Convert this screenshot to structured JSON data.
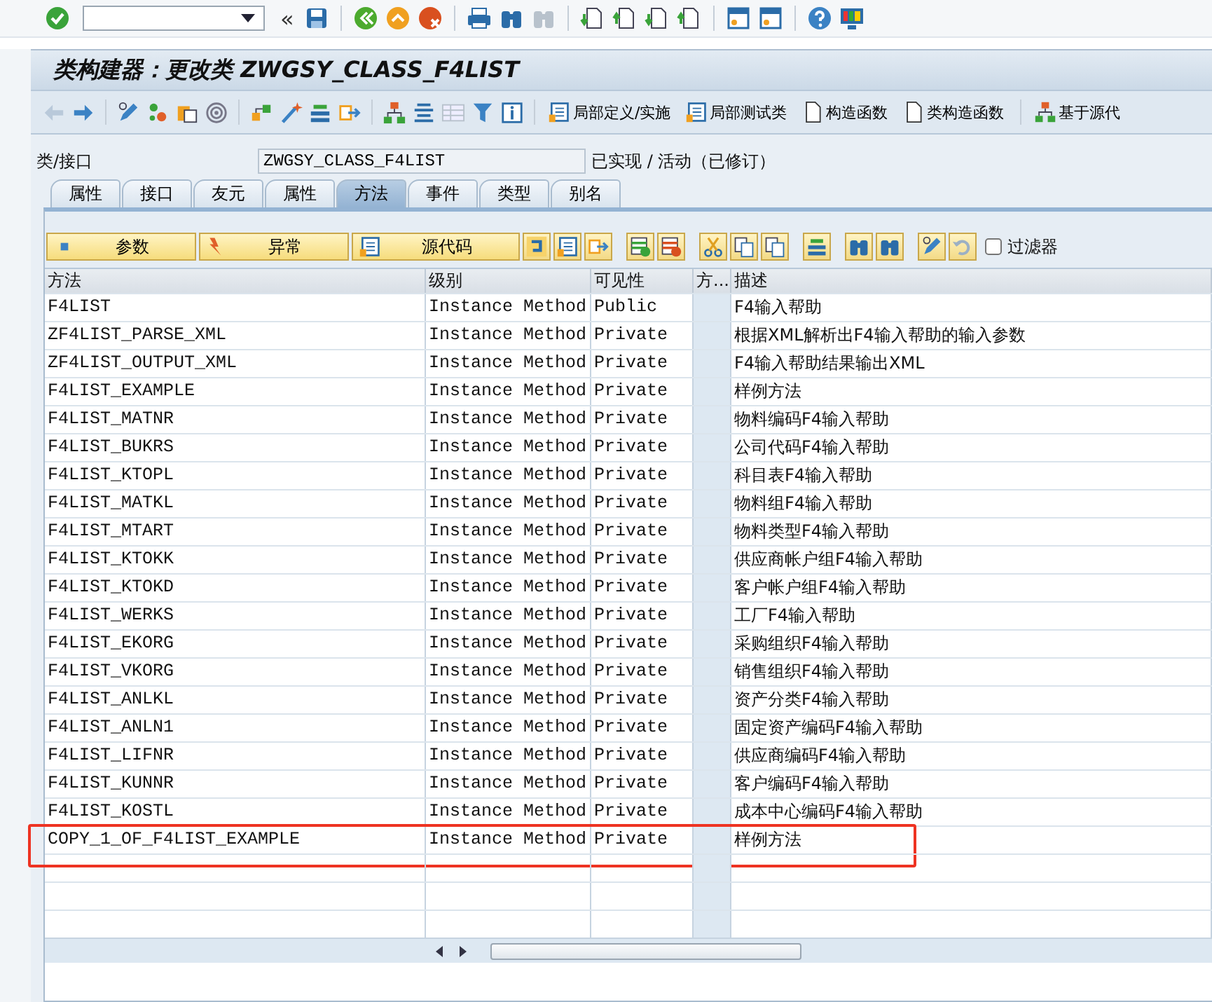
{
  "toolbar": {
    "collapse": "«"
  },
  "title": "类构建器：更改类 ZWGSY_CLASS_F4LIST",
  "app_toolbar": {
    "buttons": [
      "局部定义/实施",
      "局部测试类",
      "构造函数",
      "类构造函数",
      "基于源代"
    ]
  },
  "class_field": {
    "label": "类/接口",
    "value": "ZWGSY_CLASS_F4LIST",
    "status": "已实现 / 活动（已修订）"
  },
  "tabs": [
    {
      "label": "属性",
      "selected": false
    },
    {
      "label": "接口",
      "selected": false
    },
    {
      "label": "友元",
      "selected": false
    },
    {
      "label": "属性",
      "selected": false
    },
    {
      "label": "方法",
      "selected": true
    },
    {
      "label": "事件",
      "selected": false
    },
    {
      "label": "类型",
      "selected": false
    },
    {
      "label": "别名",
      "selected": false
    }
  ],
  "method_toolbar": {
    "buttons": [
      "参数",
      "异常",
      "源代码"
    ],
    "filter": {
      "label": "过滤器",
      "checked": false
    }
  },
  "table": {
    "columns": [
      "方法",
      "级别",
      "可见性",
      "方...",
      "描述"
    ],
    "rows": [
      {
        "method": "F4LIST",
        "scope": "Instance Method",
        "visibility": "Public",
        "description": "F4输入帮助",
        "highlighted": false
      },
      {
        "method": "ZF4LIST_PARSE_XML",
        "scope": "Instance Method",
        "visibility": "Private",
        "description": "根据XML解析出F4输入帮助的输入参数",
        "highlighted": false
      },
      {
        "method": "ZF4LIST_OUTPUT_XML",
        "scope": "Instance Method",
        "visibility": "Private",
        "description": "F4输入帮助结果输出XML",
        "highlighted": false
      },
      {
        "method": "F4LIST_EXAMPLE",
        "scope": "Instance Method",
        "visibility": "Private",
        "description": "样例方法",
        "highlighted": false
      },
      {
        "method": "F4LIST_MATNR",
        "scope": "Instance Method",
        "visibility": "Private",
        "description": "物料编码F4输入帮助",
        "highlighted": false
      },
      {
        "method": "F4LIST_BUKRS",
        "scope": "Instance Method",
        "visibility": "Private",
        "description": "公司代码F4输入帮助",
        "highlighted": false
      },
      {
        "method": "F4LIST_KTOPL",
        "scope": "Instance Method",
        "visibility": "Private",
        "description": "科目表F4输入帮助",
        "highlighted": false
      },
      {
        "method": "F4LIST_MATKL",
        "scope": "Instance Method",
        "visibility": "Private",
        "description": "物料组F4输入帮助",
        "highlighted": false
      },
      {
        "method": "F4LIST_MTART",
        "scope": "Instance Method",
        "visibility": "Private",
        "description": "物料类型F4输入帮助",
        "highlighted": false
      },
      {
        "method": "F4LIST_KTOKK",
        "scope": "Instance Method",
        "visibility": "Private",
        "description": "供应商帐户组F4输入帮助",
        "highlighted": false
      },
      {
        "method": "F4LIST_KTOKD",
        "scope": "Instance Method",
        "visibility": "Private",
        "description": "客户帐户组F4输入帮助",
        "highlighted": false
      },
      {
        "method": "F4LIST_WERKS",
        "scope": "Instance Method",
        "visibility": "Private",
        "description": "工厂F4输入帮助",
        "highlighted": false
      },
      {
        "method": "F4LIST_EKORG",
        "scope": "Instance Method",
        "visibility": "Private",
        "description": "采购组织F4输入帮助",
        "highlighted": false
      },
      {
        "method": "F4LIST_VKORG",
        "scope": "Instance Method",
        "visibility": "Private",
        "description": "销售组织F4输入帮助",
        "highlighted": false
      },
      {
        "method": "F4LIST_ANLKL",
        "scope": "Instance Method",
        "visibility": "Private",
        "description": "资产分类F4输入帮助",
        "highlighted": false
      },
      {
        "method": "F4LIST_ANLN1",
        "scope": "Instance Method",
        "visibility": "Private",
        "description": "固定资产编码F4输入帮助",
        "highlighted": false
      },
      {
        "method": "F4LIST_LIFNR",
        "scope": "Instance Method",
        "visibility": "Private",
        "description": "供应商编码F4输入帮助",
        "highlighted": false
      },
      {
        "method": "F4LIST_KUNNR",
        "scope": "Instance Method",
        "visibility": "Private",
        "description": "客户编码F4输入帮助",
        "highlighted": false
      },
      {
        "method": "F4LIST_KOSTL",
        "scope": "Instance Method",
        "visibility": "Private",
        "description": "成本中心编码F4输入帮助",
        "highlighted": false
      },
      {
        "method": "COPY_1_OF_F4LIST_EXAMPLE",
        "scope": "Instance Method",
        "visibility": "Private",
        "description": "样例方法",
        "highlighted": true
      }
    ]
  }
}
